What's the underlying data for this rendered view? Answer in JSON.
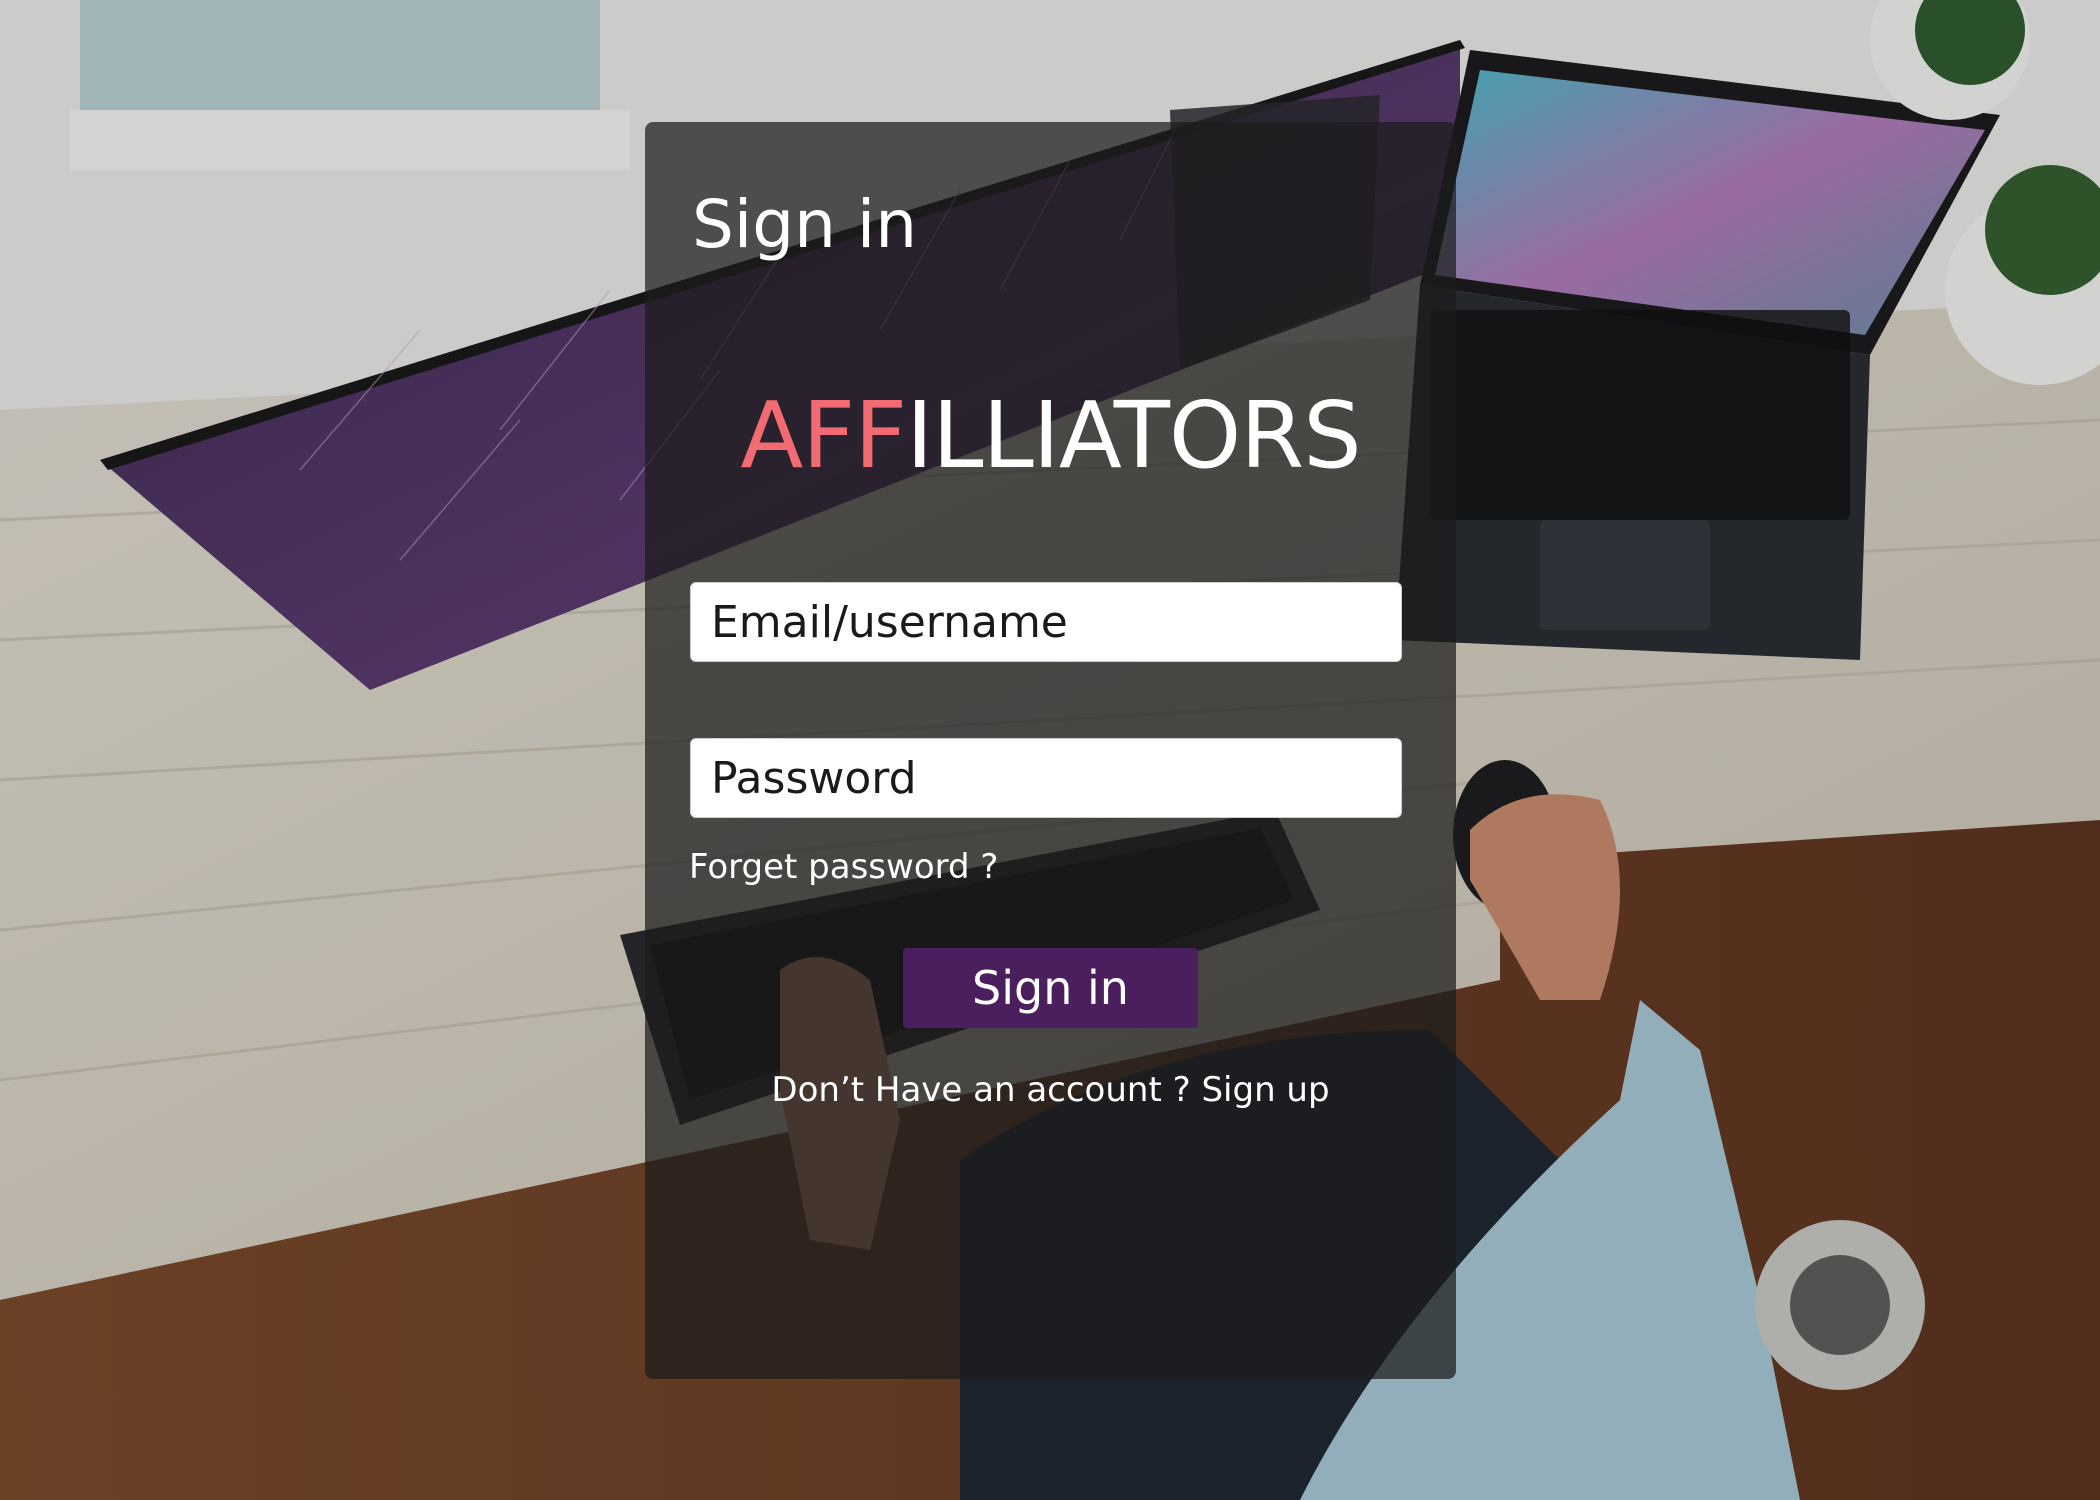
{
  "login_card": {
    "title": "Sign in",
    "brand": {
      "accent_text": "AFF",
      "rest_text": "ILLIATORS",
      "accent_color": "#f26a72"
    },
    "email_field": {
      "placeholder": "Email/username",
      "value": ""
    },
    "password_field": {
      "placeholder": "Password",
      "value": ""
    },
    "forgot_link": "Forget password ?",
    "submit_label": "Sign in",
    "signup_prompt": "Don’t Have an account ?",
    "signup_link": "Sign up"
  },
  "colors": {
    "button_bg": "#4b1f5e",
    "card_bg": "rgba(28,28,28,0.72)"
  }
}
